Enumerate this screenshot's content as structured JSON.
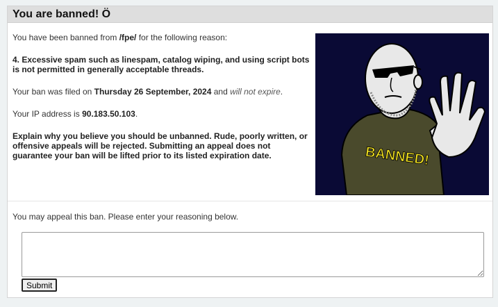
{
  "header": {
    "title": "You are banned! Ö"
  },
  "ban": {
    "intro_before": "You have been banned from ",
    "board": "/fpe/",
    "intro_after": " for the following reason:",
    "reason": "4. Excessive spam such as linespam, catalog wiping, and using script bots is not permitted in generally acceptable threads.",
    "filed_before": "Your ban was filed on ",
    "filed_date": "Thursday 26 September, 2024",
    "filed_middle": " and ",
    "expire": "will not expire",
    "filed_end": ".",
    "ip_before": "Your IP address is ",
    "ip": "90.183.50.103",
    "ip_end": ".",
    "explain": "Explain why you believe you should be unbanned. Rude, poorly written, or offensive appeals will be rejected. Submitting an appeal does not guarantee your ban will be lifted prior to its listed expiration date."
  },
  "image": {
    "shirt_text": "BANNED!",
    "colors": {
      "background": "#0a0a35",
      "shirt": "#4a4a2c",
      "shirt_text": "#f0e020"
    }
  },
  "appeal": {
    "prompt": "You may appeal this ban. Please enter your reasoning below.",
    "placeholder": "",
    "submit_label": "Submit"
  }
}
